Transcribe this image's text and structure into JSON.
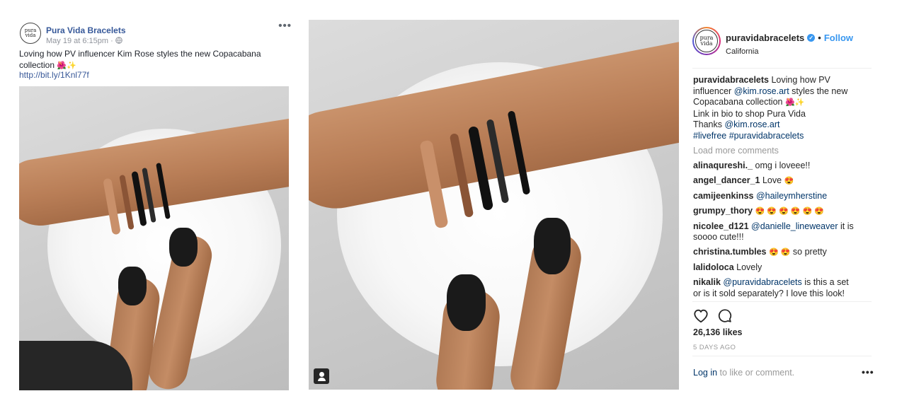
{
  "facebook_post": {
    "page_name": "Pura Vida Bracelets",
    "avatar_line1": "pura",
    "avatar_line2": "vida",
    "timestamp": "May 19 at 6:15pm",
    "timestamp_separator": "·",
    "globe_icon": "globe-icon",
    "more_label": "•••",
    "text_line1": "Loving how PV influencer Kim Rose styles the new Copacabana",
    "text_line2": "collection",
    "text_emojis": "🌺✨",
    "link": "http://bit.ly/1Knl77f"
  },
  "instagram_post": {
    "avatar_line1": "pura",
    "avatar_line2": "vida",
    "username": "puravidabracelets",
    "verified_mark": "✓",
    "dot": "•",
    "follow_label": "Follow",
    "location": "California",
    "caption": {
      "user": "puravidabracelets",
      "line1": "Loving how PV",
      "line2_pre": "influencer",
      "line2_tag": "@kim.rose.art",
      "line2_post": "styles the new",
      "line3": "Copacabana collection",
      "line3_emojis": "🌺✨",
      "line4": "Link in bio to shop Pura Vida",
      "line5_pre": "Thanks",
      "line5_tag": "@kim.rose.art",
      "hashtags": "#livefree #puravidabracelets"
    },
    "load_more": "Load more comments",
    "comments": [
      {
        "user": "alinaqureshi._",
        "tag": "",
        "text": "omg i loveee!!",
        "emojis": ""
      },
      {
        "user": "angel_dancer_1",
        "tag": "",
        "text": "Love",
        "emojis": "😍"
      },
      {
        "user": "camijeenkinss",
        "tag": "@haileymherstine",
        "text": "",
        "emojis": ""
      },
      {
        "user": "grumpy_thory",
        "tag": "",
        "text": "",
        "emojis": "😍 😍 😍 😍 😍 😍"
      },
      {
        "user": "nicolee_d121",
        "tag": "@danielle_lineweaver",
        "text": "it is",
        "text2": "soooo cute!!!",
        "emojis": ""
      },
      {
        "user": "christina.tumbles",
        "tag": "",
        "text": "so pretty",
        "emojis": "😍 😍"
      },
      {
        "user": "lalidoloca",
        "tag": "",
        "text": "Lovely",
        "emojis": ""
      },
      {
        "user": "nikalik",
        "tag": "@puravidabracelets",
        "text": "is this a set",
        "text2": "or is it sold separately? I love this look!",
        "emojis": ""
      }
    ],
    "likes": "26,136 likes",
    "date": "5 DAYS AGO",
    "login_link": "Log in",
    "login_text": "to like or comment.",
    "more_label": "•••",
    "icons": {
      "heart": "heart-icon",
      "comment": "comment-icon",
      "user_tag": "user-tag-icon"
    }
  },
  "colors": {
    "fb_link": "#385898",
    "fb_name": "#365899",
    "ig_follow": "#3897f0",
    "ig_tag": "#003569",
    "muted": "#999999"
  }
}
